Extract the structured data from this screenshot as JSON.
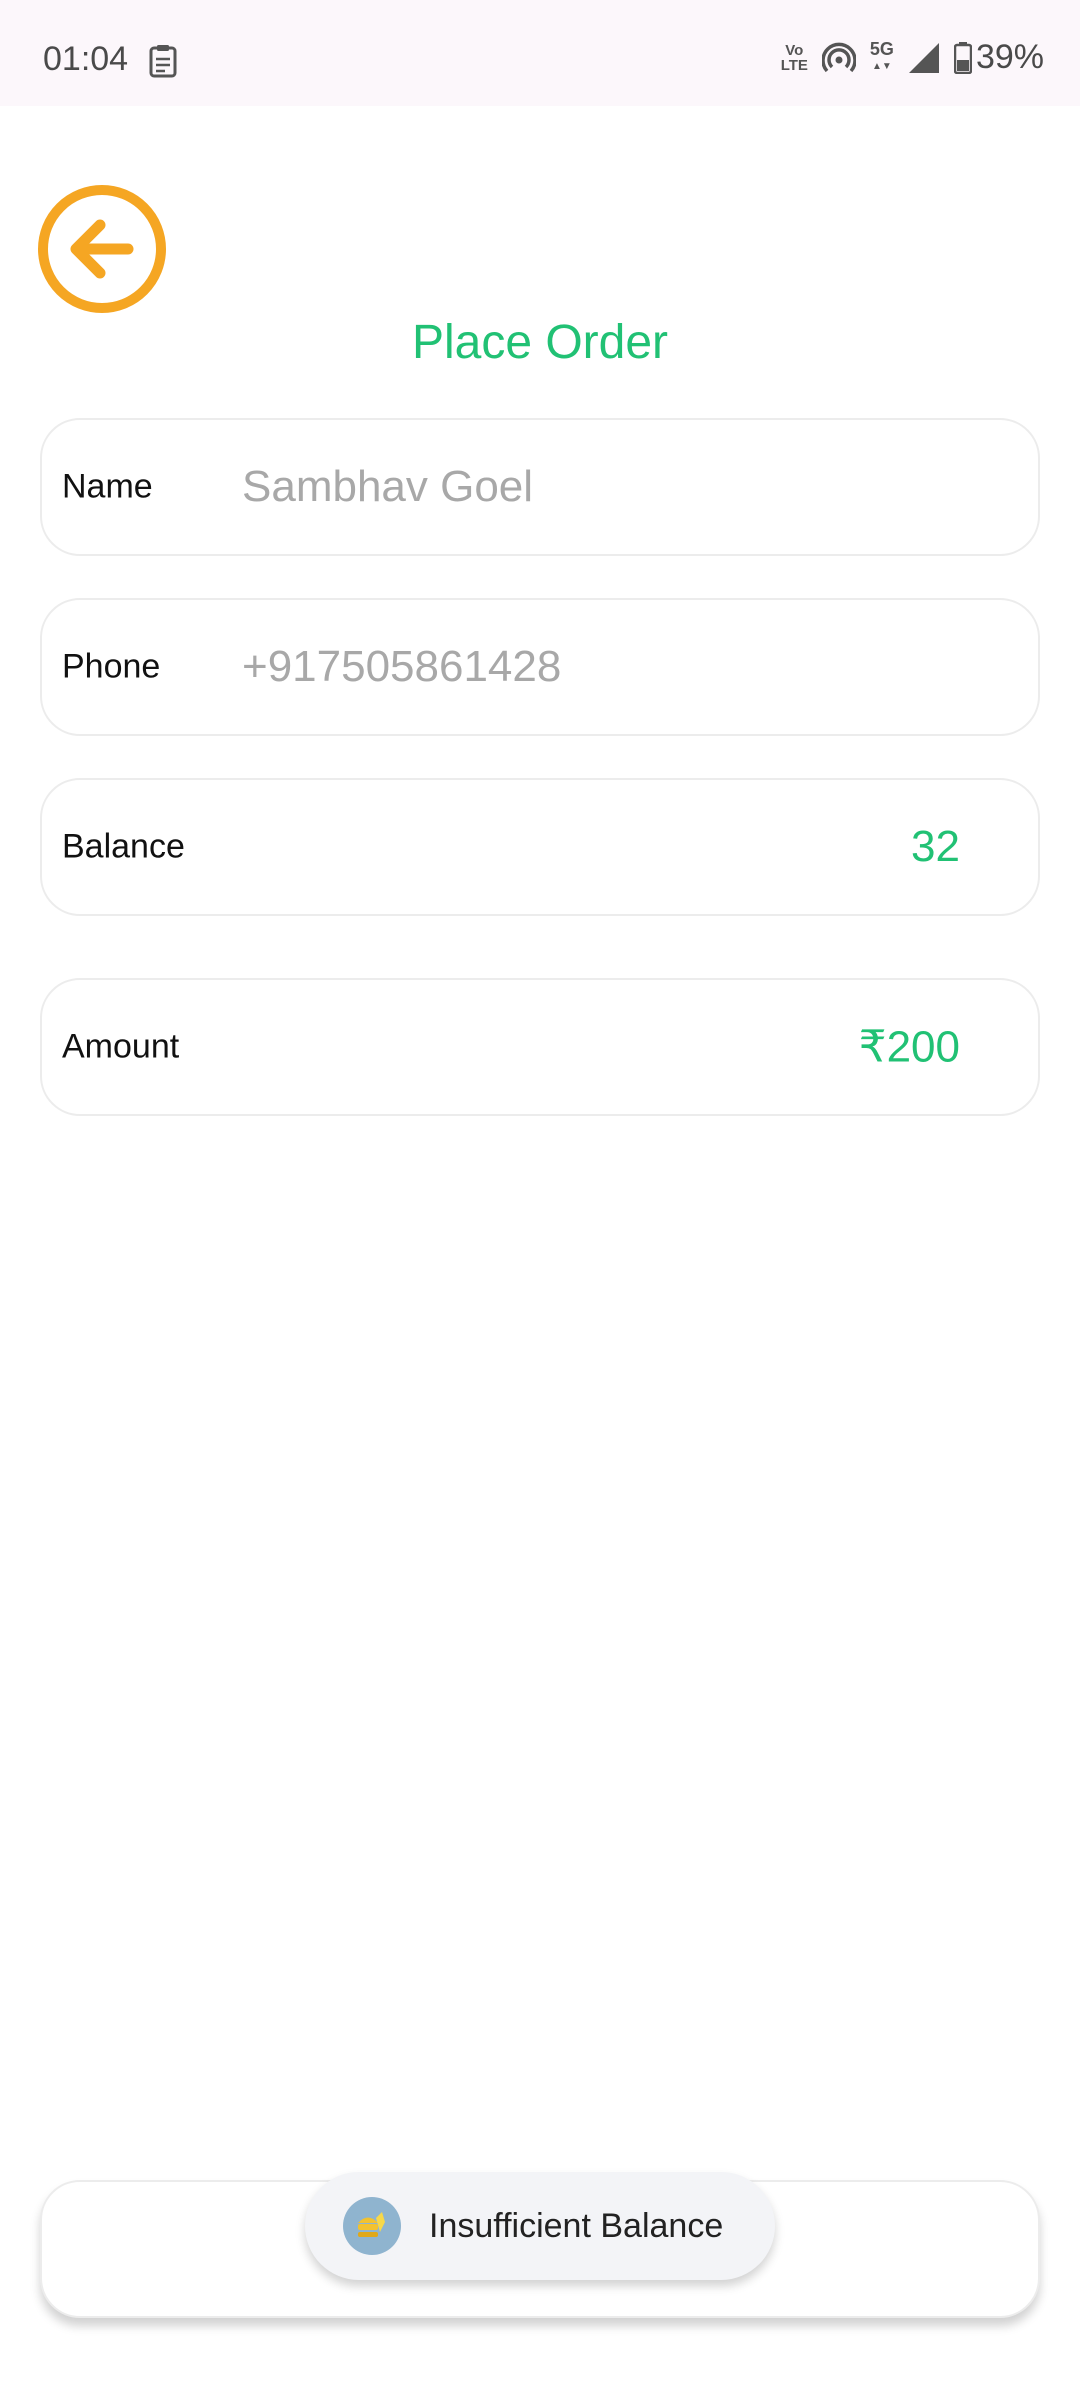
{
  "status_bar": {
    "time": "01:04",
    "volte_line1": "Vo",
    "volte_line2": "LTE",
    "network": "5G",
    "battery": "39%"
  },
  "header": {
    "title": "Place Order"
  },
  "form": {
    "name": {
      "label": "Name",
      "placeholder": "Sambhav Goel"
    },
    "phone": {
      "label": "Phone",
      "placeholder": "+917505861428"
    },
    "balance": {
      "label": "Balance",
      "value": "32"
    },
    "amount": {
      "label": "Amount",
      "value": "₹200"
    }
  },
  "toast": {
    "message": "Insufficient Balance"
  },
  "colors": {
    "accent_green": "#21c174",
    "back_orange": "#f5a623"
  }
}
